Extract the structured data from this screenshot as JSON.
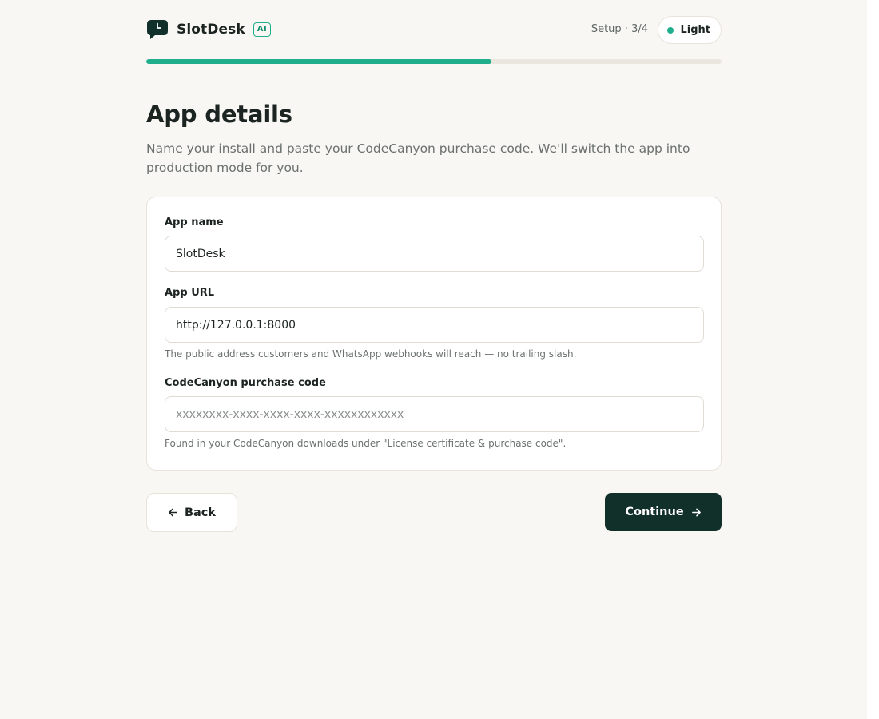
{
  "brand": {
    "name": "SlotDesk",
    "badge": "AI",
    "logo_icon": "chat-bubble-clock-icon"
  },
  "header": {
    "step_label": "Setup · 3/4",
    "theme_toggle_label": "Light"
  },
  "progress": {
    "current_step": 3,
    "total_steps": 4,
    "fill_fraction": 0.6
  },
  "page": {
    "title": "App details",
    "subtitle": "Name your install and paste your CodeCanyon purchase code. We'll switch the app into production mode for you."
  },
  "form": {
    "app_name": {
      "label": "App name",
      "value": "SlotDesk",
      "placeholder": ""
    },
    "app_url": {
      "label": "App URL",
      "value": "http://127.0.0.1:8000",
      "placeholder": "",
      "help": "The public address customers and WhatsApp webhooks will reach — no trailing slash."
    },
    "purchase_code": {
      "label": "CodeCanyon purchase code",
      "value": "",
      "placeholder": "xxxxxxxx-xxxx-xxxx-xxxx-xxxxxxxxxxxx",
      "help": "Found in your CodeCanyon downloads under \"License certificate & purchase code\"."
    }
  },
  "actions": {
    "back_label": "Back",
    "continue_label": "Continue",
    "back_icon": "arrow-left-icon",
    "continue_icon": "arrow-right-icon"
  },
  "colors": {
    "accent": "#1fae8c",
    "primary_button": "#11302a",
    "background": "#f9f7f3",
    "text": "#1c2421",
    "muted_text": "#6b716e"
  }
}
